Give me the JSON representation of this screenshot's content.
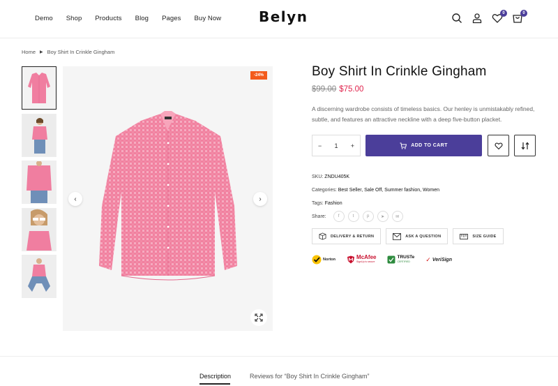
{
  "nav": {
    "items": [
      "Demo",
      "Shop",
      "Products",
      "Blog",
      "Pages",
      "Buy Now"
    ],
    "logo": "Belyn",
    "wishlist_count": "0",
    "cart_count": "0"
  },
  "breadcrumb": {
    "home": "Home",
    "current": "Boy Shirt In Crinkle Gingham"
  },
  "product": {
    "sale_badge": "-24%",
    "title": "Boy Shirt In Crinkle Gingham",
    "price_old": "$99.00",
    "price_new": "$75.00",
    "description": "A discerning wardrobe consists of timeless basics. Our henley is unmistakably refined, subtle, and features an attractive neckline with a deep five-button placket.",
    "quantity": "1",
    "add_to_cart": "ADD TO CART",
    "sku_label": "SKU:",
    "sku_value": "ZNDU405K",
    "categories_label": "Categories:",
    "categories_value": "Best Seller, Sale Off, Summer fashion, Women",
    "tags_label": "Tags:",
    "tags_value": "Fashion",
    "share_label": "Share:"
  },
  "extras": {
    "delivery": "DELIVERY & RETURN",
    "question": "ASK A QUESTION",
    "size_guide": "SIZE GUIDE"
  },
  "trust": {
    "norton": "Norton",
    "mcafee": "McAfee",
    "mcafee_sub": "SignUp is secure",
    "truste": "TRUSTe",
    "truste_sub": "CERTIFIED",
    "verisign": "VeriSign"
  },
  "tabs": {
    "description": "Description",
    "reviews": "Reviews for “Boy Shirt In Crinkle Gingham”"
  },
  "colors": {
    "accent": "#4b3e9a",
    "sale": "#f35a1b",
    "price": "#e0234c"
  }
}
